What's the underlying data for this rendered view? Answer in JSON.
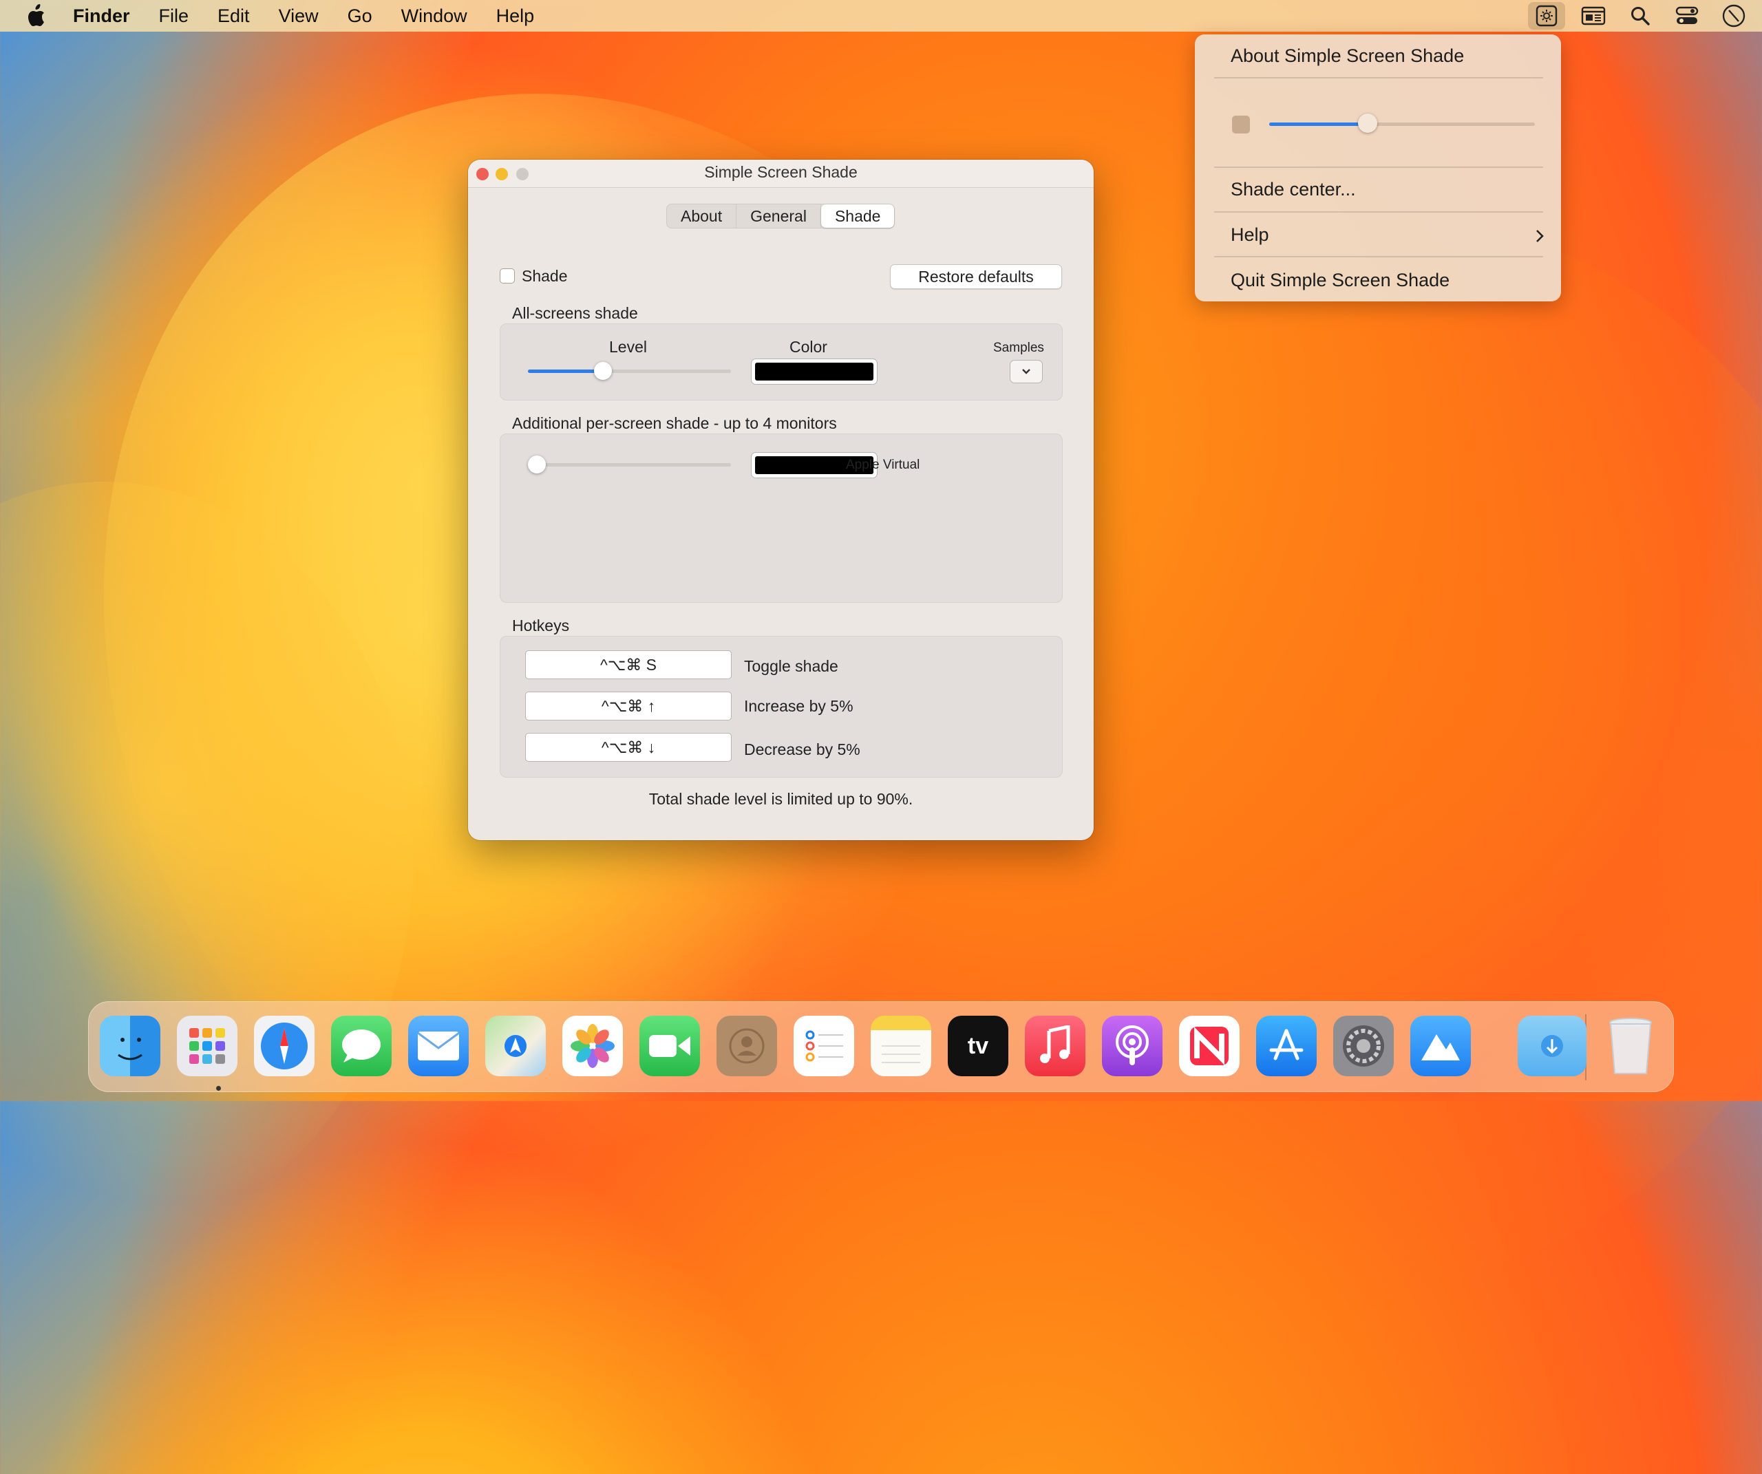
{
  "menubar": {
    "app": "Finder",
    "items": [
      "File",
      "Edit",
      "View",
      "Go",
      "Window",
      "Help"
    ]
  },
  "status_icons": [
    "screen-shade-icon",
    "keyboard-display-icon",
    "search-icon",
    "control-center-icon",
    "clock-icon"
  ],
  "dropdown": {
    "about": "About Simple Screen Shade",
    "slider_value": 0.37,
    "shade_center": "Shade center...",
    "help": "Help",
    "quit": "Quit Simple Screen Shade"
  },
  "window": {
    "title": "Simple Screen Shade",
    "tabs": [
      "About",
      "General",
      "Shade"
    ],
    "selected_tab": "Shade",
    "shade_label": "Shade",
    "shade_checked": false,
    "restore_defaults": "Restore defaults",
    "all_screens": {
      "heading": "All-screens shade",
      "level_label": "Level",
      "color_label": "Color",
      "samples_label": "Samples",
      "level_value": 0.37,
      "color": "#000000"
    },
    "per_screen": {
      "heading": "Additional per-screen shade - up to 4 monitors",
      "level_value": 0.0,
      "color": "#000000",
      "monitor": "Apple Virtual"
    },
    "hotkeys": {
      "heading": "Hotkeys",
      "items": [
        {
          "keys": "^⌥⌘ S",
          "action": "Toggle shade"
        },
        {
          "keys": "^⌥⌘ ↑",
          "action": "Increase by 5%"
        },
        {
          "keys": "^⌥⌘ ↓",
          "action": "Decrease by 5%"
        }
      ]
    },
    "footer": "Total shade level is limited up to 90%."
  },
  "dock": {
    "apps": [
      "finder-icon",
      "launchpad-icon",
      "safari-icon",
      "messages-icon",
      "mail-icon",
      "maps-icon",
      "photos-icon",
      "facetime-icon",
      "contacts-icon",
      "reminders-icon",
      "notes-icon",
      "tv-icon",
      "music-icon",
      "podcasts-icon",
      "news-icon",
      "app-store-icon",
      "system-settings-icon",
      "monterey-installer-icon",
      "downloads-folder-icon",
      "trash-icon"
    ],
    "tv_label": "tv"
  }
}
